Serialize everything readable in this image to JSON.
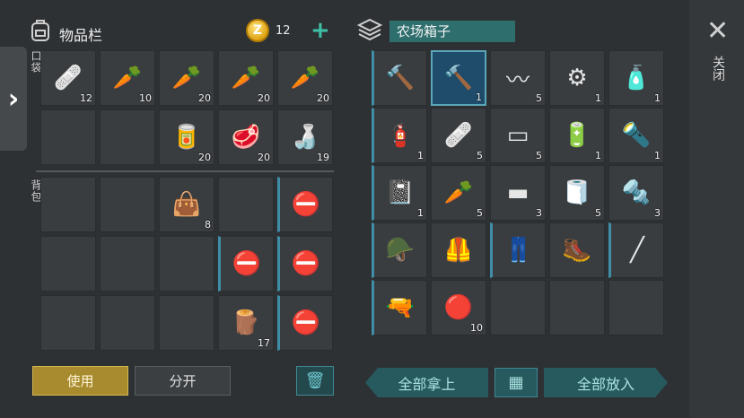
{
  "left_panel": {
    "title": "物品栏",
    "coin_symbol": "Z",
    "coin_count": "12",
    "plus_label": "+",
    "pocket_label": "口袋",
    "backpack_label": "背包",
    "pocket_slots": [
      {
        "icon": "bandage-icon",
        "glyph": "🩹",
        "count": "12"
      },
      {
        "icon": "carrot-icon",
        "glyph": "🥕",
        "count": "10"
      },
      {
        "icon": "carrot-icon",
        "glyph": "🥕",
        "count": "20"
      },
      {
        "icon": "carrot-icon",
        "glyph": "🥕",
        "count": "20"
      },
      {
        "icon": "carrot-icon",
        "glyph": "🥕",
        "count": "20"
      },
      {
        "icon": "",
        "glyph": "",
        "count": ""
      },
      {
        "icon": "",
        "glyph": "",
        "count": ""
      },
      {
        "icon": "canned-food-icon",
        "glyph": "🥫",
        "count": "20"
      },
      {
        "icon": "raw-meat-icon",
        "glyph": "🥩",
        "count": "20"
      },
      {
        "icon": "water-bottle-icon",
        "glyph": "🍶",
        "count": "19"
      }
    ],
    "backpack_slots": [
      {
        "icon": "",
        "glyph": "",
        "count": ""
      },
      {
        "icon": "",
        "glyph": "",
        "count": ""
      },
      {
        "icon": "medkit-bag-icon",
        "glyph": "👜",
        "count": "8"
      },
      {
        "icon": "",
        "glyph": "",
        "count": ""
      },
      {
        "icon": "stop-sign-icon",
        "glyph": "⛔",
        "count": ""
      },
      {
        "icon": "",
        "glyph": "",
        "count": ""
      },
      {
        "icon": "",
        "glyph": "",
        "count": ""
      },
      {
        "icon": "",
        "glyph": "",
        "count": ""
      },
      {
        "icon": "stop-sign-icon",
        "glyph": "⛔",
        "count": ""
      },
      {
        "icon": "stop-sign-icon",
        "glyph": "⛔",
        "count": ""
      },
      {
        "icon": "",
        "glyph": "",
        "count": ""
      },
      {
        "icon": "",
        "glyph": "",
        "count": ""
      },
      {
        "icon": "",
        "glyph": "",
        "count": ""
      },
      {
        "icon": "log-icon",
        "glyph": "🪵",
        "count": "17"
      },
      {
        "icon": "stop-sign-icon",
        "glyph": "⛔",
        "count": ""
      }
    ],
    "use_label": "使用",
    "split_label": "分开",
    "trash_glyph": "🗑"
  },
  "right_panel": {
    "title": "农场箱子",
    "slots": [
      {
        "icon": "hammer-icon",
        "glyph": "🔨",
        "count": ""
      },
      {
        "icon": "blueprint-hammer-icon",
        "glyph": "🔨",
        "count": "1"
      },
      {
        "icon": "spring-icon",
        "glyph": "〰",
        "count": "5"
      },
      {
        "icon": "engine-part-icon",
        "glyph": "⚙",
        "count": "1"
      },
      {
        "icon": "spray-can-icon",
        "glyph": "🧴",
        "count": "1"
      },
      {
        "icon": "spray-can-red-icon",
        "glyph": "🧯",
        "count": "1"
      },
      {
        "icon": "bandage-icon",
        "glyph": "🩹",
        "count": "5"
      },
      {
        "icon": "metal-bars-icon",
        "glyph": "▭",
        "count": "5"
      },
      {
        "icon": "battery-icon",
        "glyph": "🔋",
        "count": "1"
      },
      {
        "icon": "flashlight-icon",
        "glyph": "🔦",
        "count": "1"
      },
      {
        "icon": "notebook-icon",
        "glyph": "📓",
        "count": "1"
      },
      {
        "icon": "carrot-icon",
        "glyph": "🥕",
        "count": "5"
      },
      {
        "icon": "copper-bar-icon",
        "glyph": "▬",
        "count": "3"
      },
      {
        "icon": "cloth-icon",
        "glyph": "🧻",
        "count": "5"
      },
      {
        "icon": "bolt-nut-icon",
        "glyph": "🔩",
        "count": "3"
      },
      {
        "icon": "helmet-goggles-icon",
        "glyph": "🪖",
        "count": ""
      },
      {
        "icon": "armor-vest-icon",
        "glyph": "🦺",
        "count": ""
      },
      {
        "icon": "pants-icon",
        "glyph": "👖",
        "count": ""
      },
      {
        "icon": "boots-icon",
        "glyph": "🥾",
        "count": ""
      },
      {
        "icon": "crowbar-icon",
        "glyph": "╱",
        "count": ""
      },
      {
        "icon": "rifle-icon",
        "glyph": "🔫",
        "count": ""
      },
      {
        "icon": "bottle-cap-icon",
        "glyph": "🔴",
        "count": "10"
      },
      {
        "icon": "",
        "glyph": "",
        "count": ""
      },
      {
        "icon": "",
        "glyph": "",
        "count": ""
      },
      {
        "icon": "",
        "glyph": "",
        "count": ""
      }
    ],
    "take_all_label": "全部拿上",
    "grid_glyph": "▦",
    "put_all_label": "全部放入"
  },
  "close": {
    "x_glyph": "✕",
    "label": "关闭"
  },
  "colors": {
    "accent_teal": "#3fc1a8",
    "use_button": "#a88b2e"
  }
}
